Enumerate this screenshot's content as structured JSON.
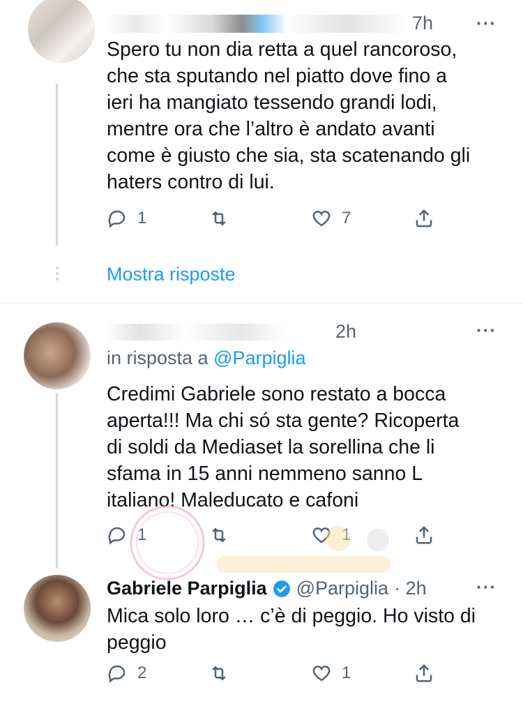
{
  "tweets": [
    {
      "header_time": "7h",
      "text": "Spero tu non dia retta a quel rancoroso,\nche sta sputando nel piatto dove fino a\nieri ha mangiato tessendo grandi lodi,\nmentre ora che l’altro è andato avanti\ncome è giusto che sia, sta scatenando gli\nhaters contro di lui.",
      "reply_count": "1",
      "retweet_count": "",
      "like_count": "7"
    },
    {
      "header_time": "2h",
      "reply_to_prefix": "in risposta a",
      "reply_to_handle": "@Parpiglia",
      "text": "Credimi Gabriele sono restato a bocca\naperta!!! Ma chi só sta gente?  Ricoperta\ndi soldi da Mediaset la sorellina che li\nsfama in 15 anni  nemmeno sanno L\nitaliano! Maleducato e cafoni",
      "reply_count": "1",
      "retweet_count": "",
      "like_count": "1"
    },
    {
      "name": "Gabriele Parpiglia",
      "handle": "@Parpiglia",
      "time": "· 2h",
      "text": "Mica solo loro … c’è di peggio. Ho visto di\npeggio",
      "reply_count": "2",
      "retweet_count": "",
      "like_count": "1"
    }
  ],
  "show_replies_label": "Mostra risposte",
  "more_label": "···",
  "icons": {
    "reply": "reply-icon",
    "retweet": "retweet-icon",
    "like": "like-icon",
    "share": "share-icon",
    "verified": "verified-badge-icon"
  },
  "colors": {
    "text": "#0f1419",
    "secondary": "#536471",
    "link": "#1d9bf0",
    "verified": "#1d9bf0"
  }
}
